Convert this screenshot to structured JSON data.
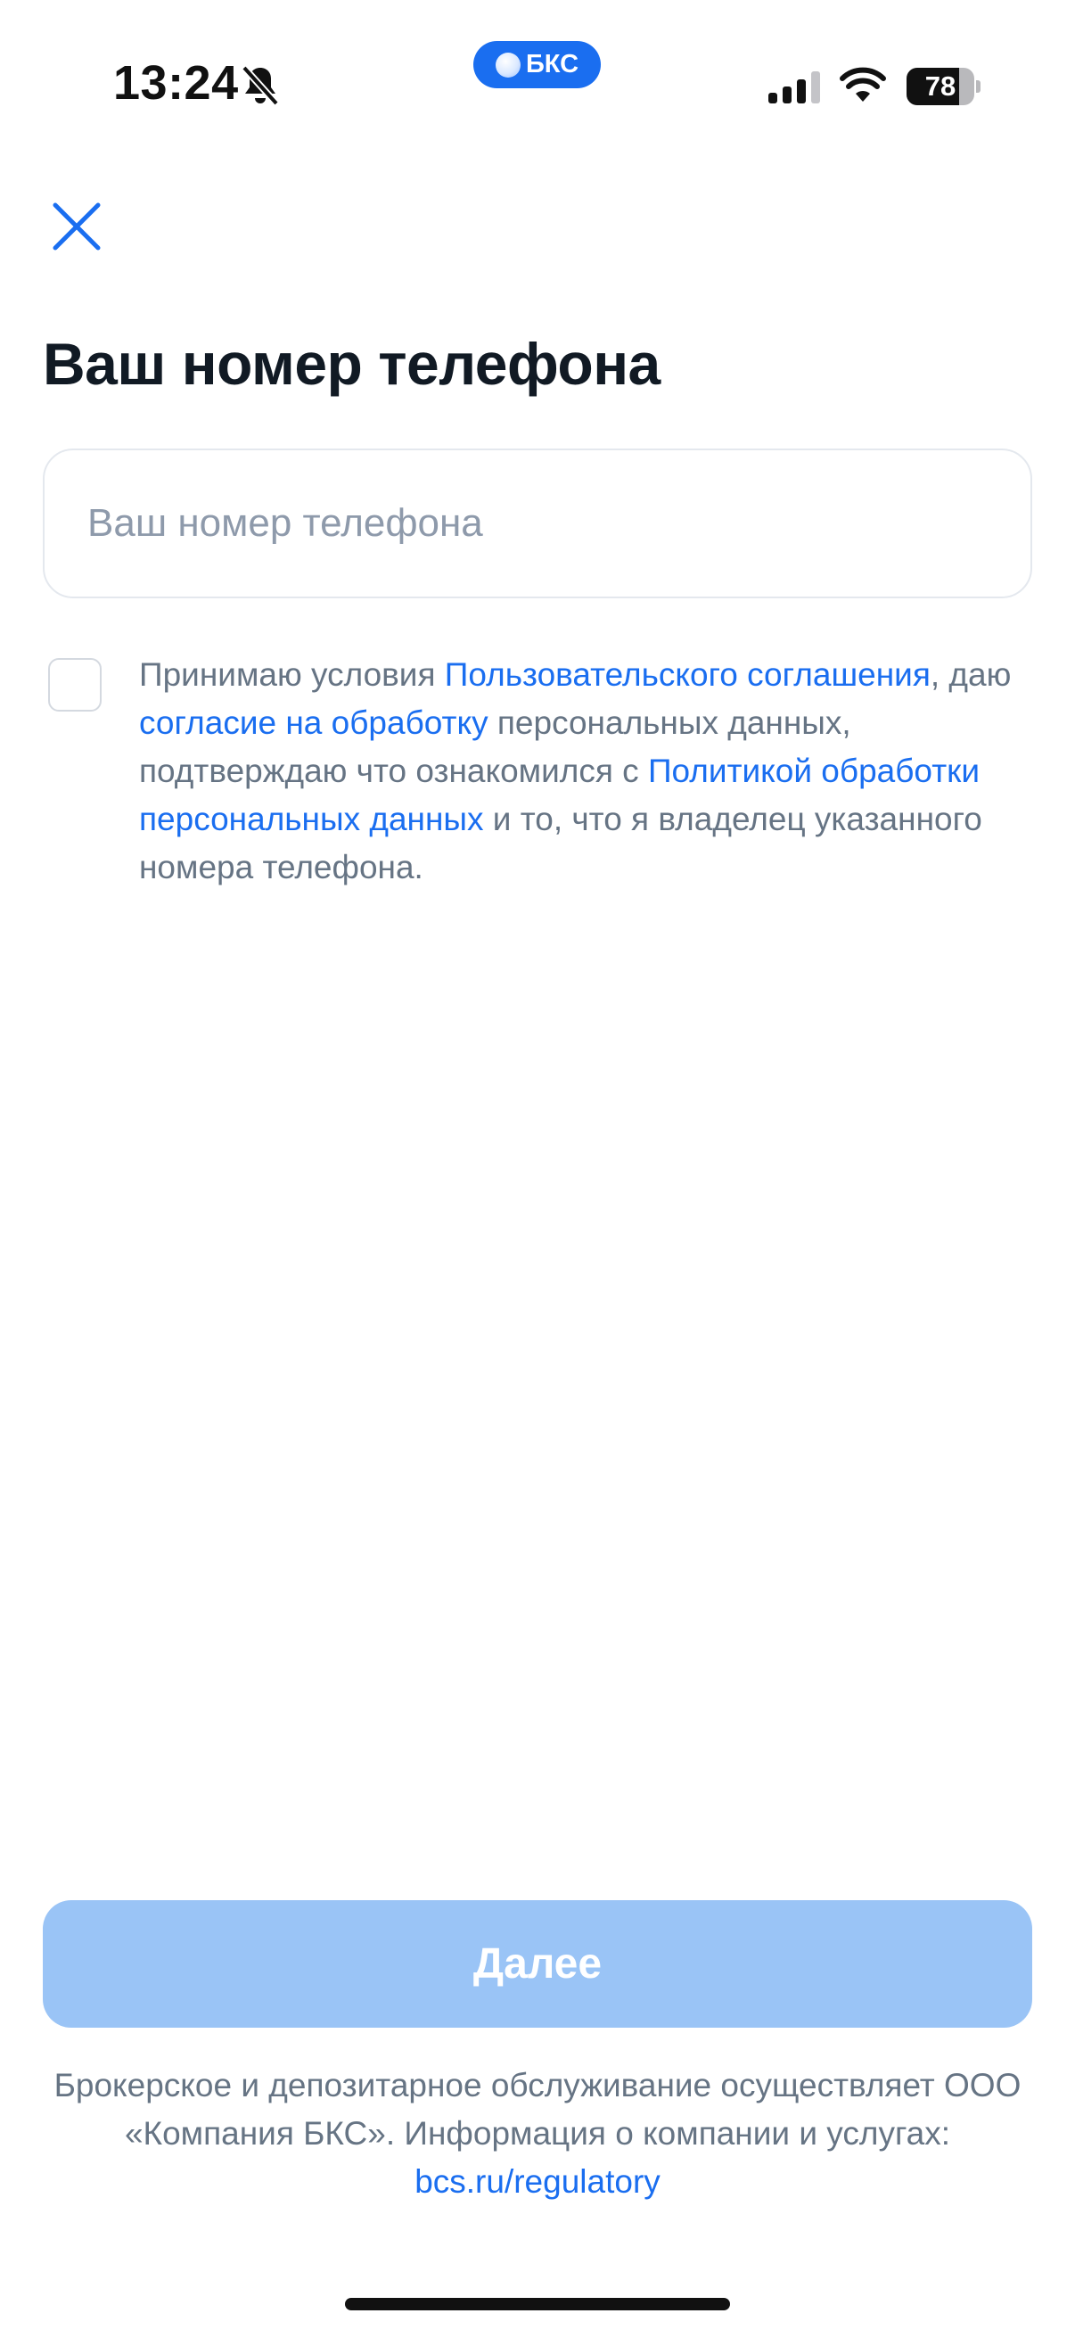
{
  "status_bar": {
    "time": "13:24",
    "app_label": "БКС",
    "battery_level": "78",
    "battery_fraction": 0.78,
    "icons": [
      "bell-slash-icon",
      "signal-icon",
      "wifi-icon",
      "battery-icon"
    ]
  },
  "header": {
    "close_icon": "close-icon"
  },
  "title": "Ваш номер телефона",
  "phone_input": {
    "placeholder": "Ваш номер телефона",
    "value": ""
  },
  "consent": {
    "checked": false,
    "text_1": "Принимаю условия ",
    "link_user_agreement": "Пользовательского соглашения",
    "text_2": ", даю ",
    "link_consent": "согласие на обработку",
    "text_3": " персональных данных, подтверждаю что ознакомился с ",
    "link_policy": "Политикой обработки персональных данных",
    "text_4": " и то, что я владелец указанного номера телефона."
  },
  "next_button": {
    "label": "Далее",
    "enabled": false
  },
  "footer": {
    "text_1": "Брокерское и депозитарное обслуживание осуществляет ООО «Компания БКС». Информация о компании и услугах: ",
    "link": "bcs.ru/regulatory"
  },
  "colors": {
    "accent": "#1a6ef0",
    "button_disabled": "#9ac4f6",
    "muted_text": "#667484",
    "title_text": "#111a24"
  }
}
